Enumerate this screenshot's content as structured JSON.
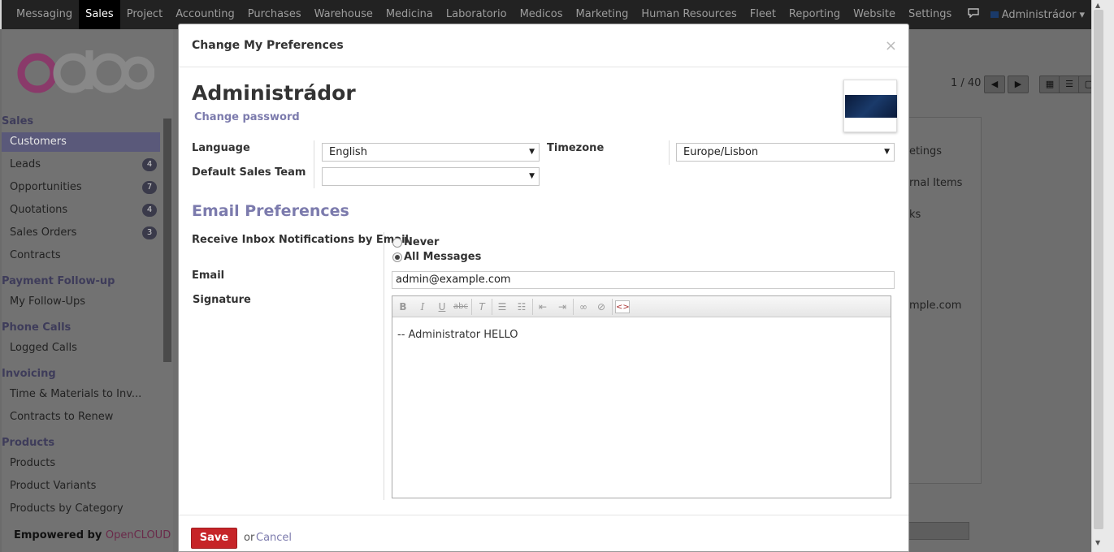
{
  "topbar": {
    "menu": [
      "Messaging",
      "Sales",
      "Project",
      "Accounting",
      "Purchases",
      "Warehouse",
      "Medicina",
      "Laboratorio",
      "Medicos",
      "Marketing",
      "Human Resources",
      "Fleet",
      "Reporting",
      "Website",
      "Settings"
    ],
    "active": "Sales",
    "user": "Administrádor"
  },
  "sidebar": {
    "logo": "odoo",
    "sections": [
      {
        "title": "Sales",
        "items": [
          {
            "label": "Customers",
            "badge": ""
          },
          {
            "label": "Leads",
            "badge": "4"
          },
          {
            "label": "Opportunities",
            "badge": "7"
          },
          {
            "label": "Quotations",
            "badge": "4"
          },
          {
            "label": "Sales Orders",
            "badge": "3"
          },
          {
            "label": "Contracts",
            "badge": ""
          }
        ]
      },
      {
        "title": "Payment Follow-up",
        "items": [
          {
            "label": "My Follow-Ups",
            "badge": ""
          }
        ]
      },
      {
        "title": "Phone Calls",
        "items": [
          {
            "label": "Logged Calls",
            "badge": ""
          }
        ]
      },
      {
        "title": "Invoicing",
        "items": [
          {
            "label": "Time & Materials to Inv...",
            "badge": ""
          },
          {
            "label": "Contracts to Renew",
            "badge": ""
          }
        ]
      },
      {
        "title": "Products",
        "items": [
          {
            "label": "Products",
            "badge": ""
          },
          {
            "label": "Product Variants",
            "badge": ""
          },
          {
            "label": "Products by Category",
            "badge": ""
          }
        ]
      }
    ],
    "powered_by": "Empowered by",
    "powered_brand": "OpenCLOUD"
  },
  "background": {
    "pager": "1 / 40",
    "card_items": [
      "etings",
      "rnal Items",
      "ks",
      "mple.com"
    ]
  },
  "modal": {
    "title": "Change My Preferences",
    "close": "×",
    "user_name": "Administrádor",
    "change_password": "Change password",
    "language_label": "Language",
    "language_value": "English",
    "timezone_label": "Timezone",
    "timezone_value": "Europe/Lisbon",
    "sales_team_label": "Default Sales Team",
    "sales_team_value": "",
    "email_prefs_heading": "Email Preferences",
    "notif_label": "Receive Inbox Notifications by Email",
    "notif_options": [
      "Never",
      "All Messages"
    ],
    "notif_selected": "All Messages",
    "email_label": "Email",
    "email_value": "admin@example.com",
    "signature_label": "Signature",
    "signature_value": "-- Administrator HELLO",
    "save": "Save",
    "or": "or",
    "cancel": "Cancel"
  }
}
